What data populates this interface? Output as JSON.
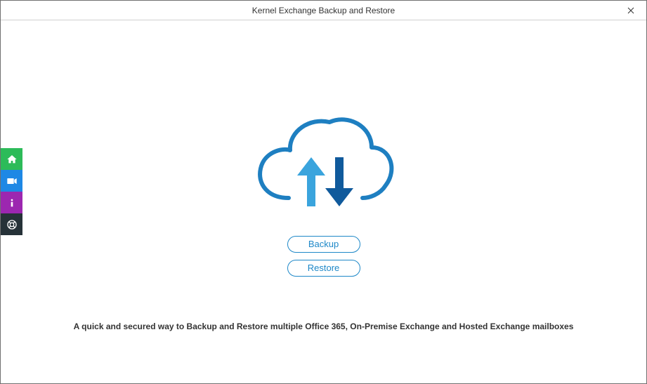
{
  "window": {
    "title": "Kernel Exchange Backup and Restore"
  },
  "sidebar": {
    "home": "Home",
    "video": "Video",
    "info": "About",
    "help": "Help"
  },
  "actions": {
    "backup_label": "Backup",
    "restore_label": "Restore"
  },
  "tagline": "A quick and secured way to Backup and Restore multiple Office 365, On-Premise Exchange and Hosted Exchange mailboxes",
  "colors": {
    "accent": "#1e88c8",
    "cloud_light": "#2a9fd6",
    "cloud_dark": "#105a9c"
  }
}
